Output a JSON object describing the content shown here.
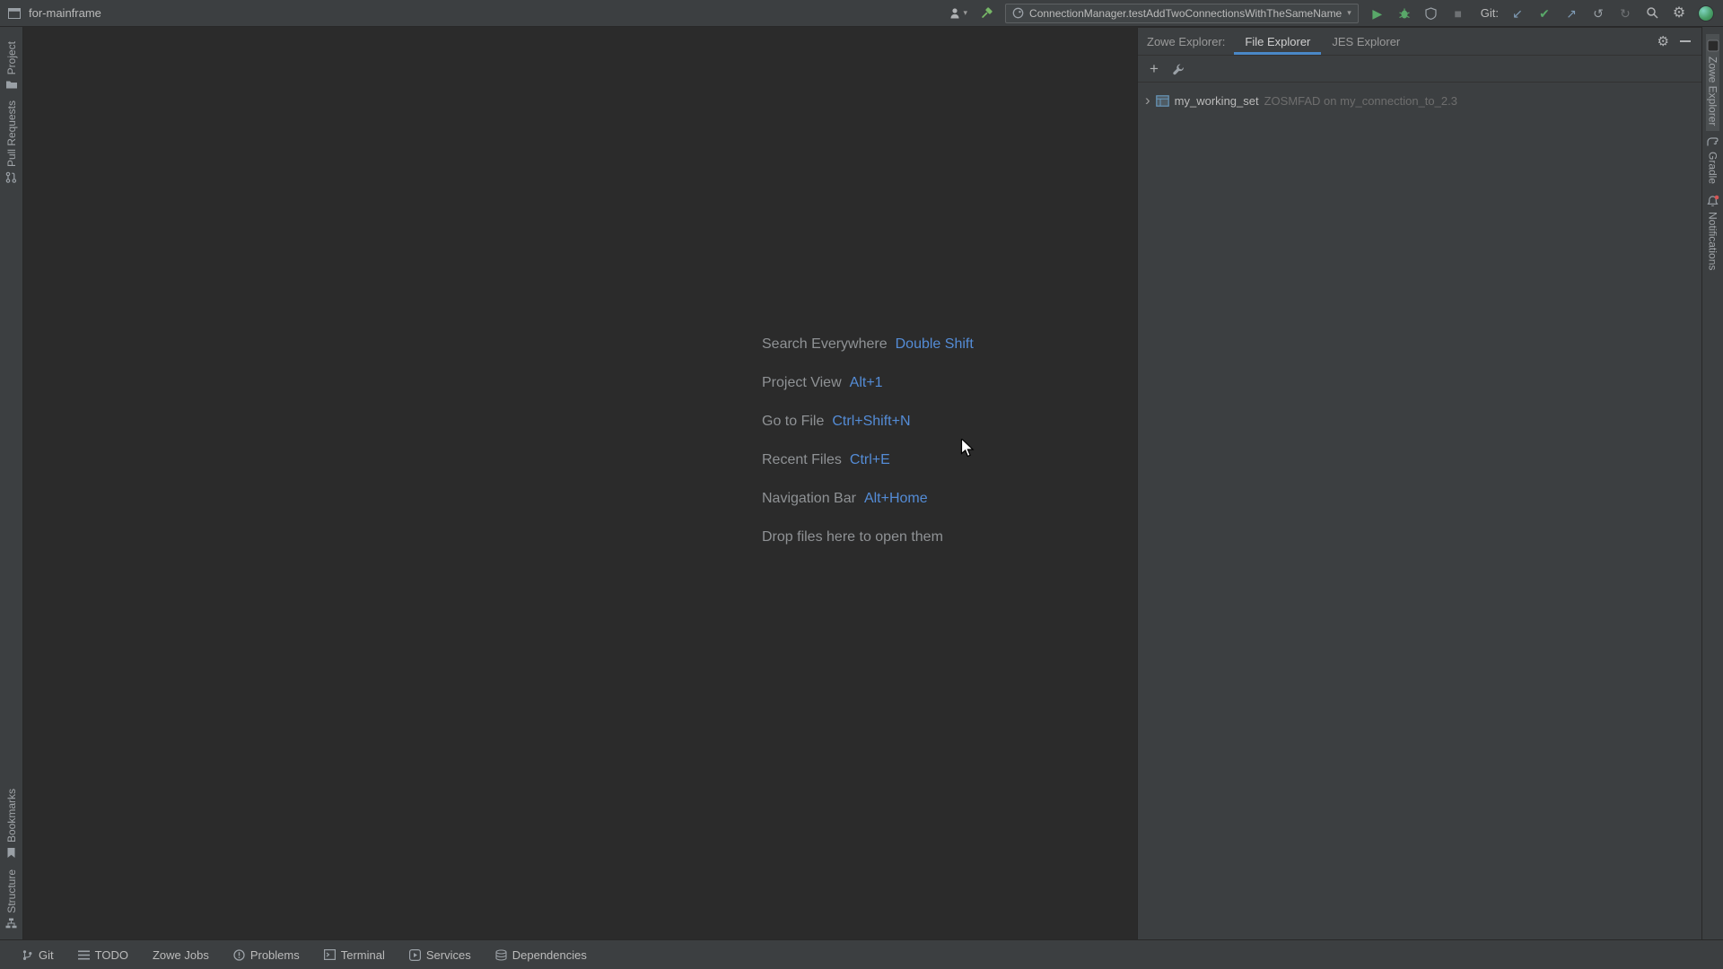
{
  "titlebar": {
    "project": "for-mainframe",
    "run_config": "ConnectionManager.testAddTwoConnectionsWithTheSameName",
    "git_label": "Git:"
  },
  "left_stripe": {
    "project": "Project",
    "pull_requests": "Pull Requests",
    "bookmarks": "Bookmarks",
    "structure": "Structure"
  },
  "editor_hints": {
    "rows": [
      {
        "label": "Search Everywhere",
        "shortcut": "Double Shift"
      },
      {
        "label": "Project View",
        "shortcut": "Alt+1"
      },
      {
        "label": "Go to File",
        "shortcut": "Ctrl+Shift+N"
      },
      {
        "label": "Recent Files",
        "shortcut": "Ctrl+E"
      },
      {
        "label": "Navigation Bar",
        "shortcut": "Alt+Home"
      },
      {
        "label": "Drop files here to open them",
        "shortcut": ""
      }
    ]
  },
  "zowe_panel": {
    "title": "Zowe Explorer:",
    "tabs": [
      {
        "label": "File Explorer"
      },
      {
        "label": "JES Explorer"
      }
    ],
    "tree_item": {
      "name": "my_working_set",
      "detail": "ZOSMFAD on my_connection_to_2.3"
    }
  },
  "right_stripe": {
    "zowe_explorer": "Zowe Explorer",
    "gradle": "Gradle",
    "notifications": "Notifications"
  },
  "bottom_bar": {
    "items": [
      {
        "label": "Git"
      },
      {
        "label": "TODO"
      },
      {
        "label": "Zowe Jobs"
      },
      {
        "label": "Problems"
      },
      {
        "label": "Terminal"
      },
      {
        "label": "Services"
      },
      {
        "label": "Dependencies"
      }
    ]
  },
  "icons": {
    "play": "▶",
    "stop": "■",
    "gear": "⚙",
    "plus": "+",
    "caret_down": "▾",
    "chevron_right": "›",
    "check": "✔",
    "arrow_up_right": "↗",
    "arrow_down_left": "↙",
    "rotate_ccw": "↺",
    "rotate_cw": "↻"
  },
  "colors": {
    "editor_bg": "#2b2b2b",
    "panel_bg": "#3c3f41",
    "accent_blue": "#548cd6",
    "tab_underline": "#4a88c7",
    "run_green": "#59a869",
    "notification_red": "#d55555"
  }
}
